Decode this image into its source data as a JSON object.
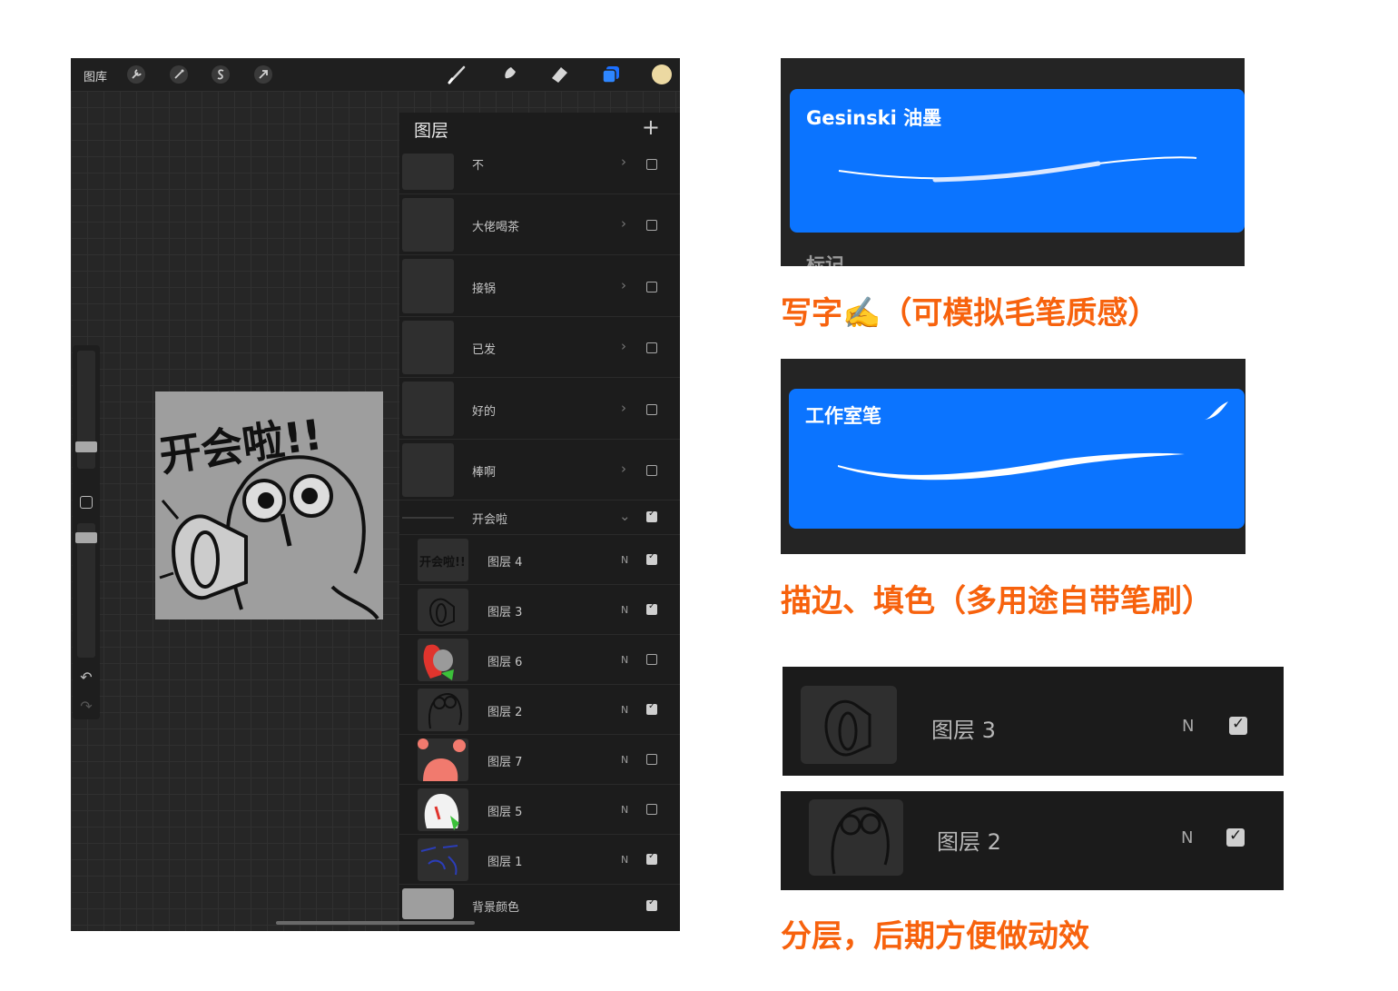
{
  "colors": {
    "accent_blue": "#0b74ff",
    "caption_orange": "#f7620d",
    "panel_bg": "#1c1c1c",
    "current_color": "#ecd9a2"
  },
  "toolbar": {
    "gallery_label": "图库",
    "left_tools": [
      "wrench-icon",
      "magic-wand-icon",
      "selection-s-icon",
      "arrow-transform-icon"
    ],
    "right_tools": [
      "brush-icon",
      "smudge-icon",
      "eraser-icon",
      "layers-icon",
      "color-swatch"
    ]
  },
  "layers": {
    "title": "图层",
    "add_label": "+",
    "groups": [
      {
        "name": "不",
        "visible": false
      },
      {
        "name": "大佬喝茶",
        "visible": false
      },
      {
        "name": "接锅",
        "visible": false
      },
      {
        "name": "已发",
        "visible": false
      },
      {
        "name": "好的",
        "visible": false
      },
      {
        "name": "棒啊",
        "visible": false
      }
    ],
    "open_group": {
      "name": "开会啦",
      "visible": true
    },
    "children": [
      {
        "name": "图层 4",
        "blend": "N",
        "visible": true
      },
      {
        "name": "图层 3",
        "blend": "N",
        "visible": true
      },
      {
        "name": "图层 6",
        "blend": "N",
        "visible": false
      },
      {
        "name": "图层 2",
        "blend": "N",
        "visible": true
      },
      {
        "name": "图层 7",
        "blend": "N",
        "visible": false
      },
      {
        "name": "图层 5",
        "blend": "N",
        "visible": false
      },
      {
        "name": "图层 1",
        "blend": "N",
        "visible": true
      }
    ],
    "background": {
      "name": "背景颜色",
      "visible": true
    }
  },
  "artwork": {
    "title_text": "开会啦!!"
  },
  "brush1": {
    "name": "Gesinski 油墨",
    "next_section": "标记"
  },
  "brush2": {
    "name": "工作室笔"
  },
  "captions": {
    "c1": "写字✍️（可模拟毛笔质感）",
    "c2": "描边、填色（多用途自带笔刷）",
    "c3": "分层，后期方便做动效"
  },
  "zoom_layers": [
    {
      "name": "图层 3",
      "blend": "N",
      "visible": true
    },
    {
      "name": "图层 2",
      "blend": "N",
      "visible": true
    }
  ]
}
